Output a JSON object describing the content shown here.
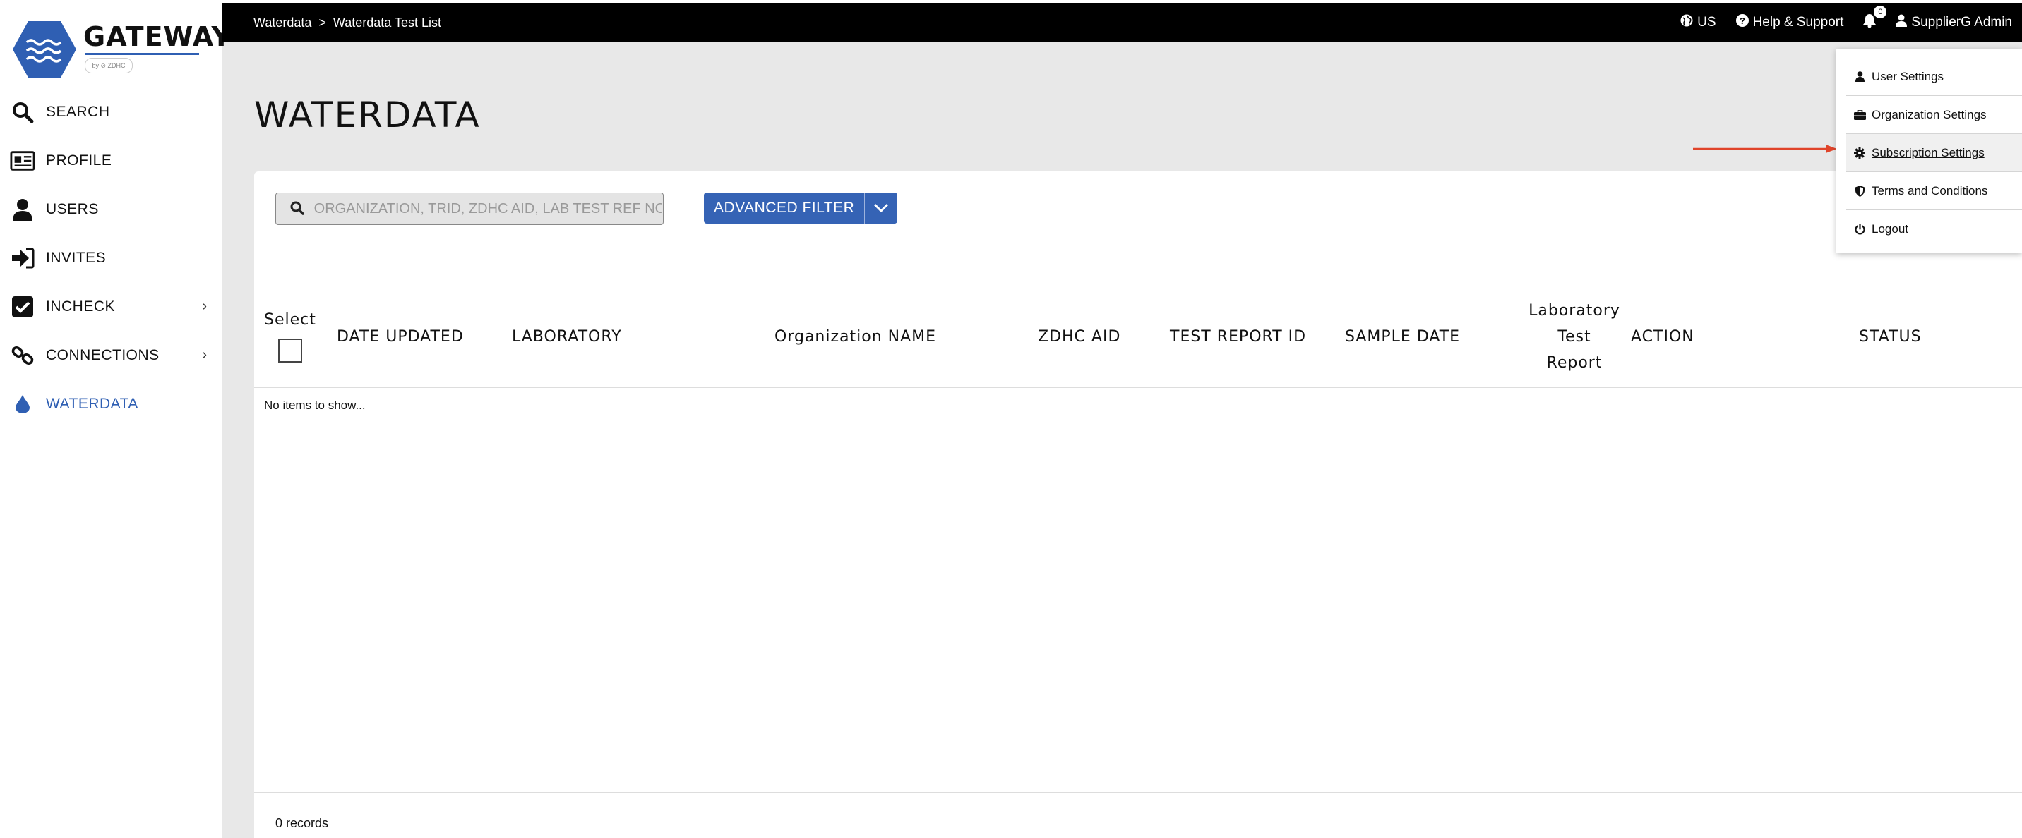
{
  "brand": {
    "name": "GATEWAY",
    "tagline": "by ⊘ ZDHC"
  },
  "sidebar": {
    "items": [
      {
        "label": "SEARCH",
        "icon": "search-icon"
      },
      {
        "label": "PROFILE",
        "icon": "profile-card-icon"
      },
      {
        "label": "USERS",
        "icon": "user-icon"
      },
      {
        "label": "INVITES",
        "icon": "sign-in-icon"
      },
      {
        "label": "INCHECK",
        "icon": "checkbox-icon",
        "has_submenu": true
      },
      {
        "label": "CONNECTIONS",
        "icon": "link-icon",
        "has_submenu": true
      },
      {
        "label": "WATERDATA",
        "icon": "water-drop-icon",
        "active": true
      }
    ]
  },
  "topbar": {
    "breadcrumb": [
      "Waterdata",
      "Waterdata Test List"
    ],
    "breadcrumb_separator": ">",
    "region": "US",
    "help": "Help & Support",
    "notifications": "0",
    "user": "SupplierG Admin"
  },
  "page": {
    "title": "WATERDATA",
    "search": {
      "placeholder": "ORGANIZATION, TRID, ZDHC AID, LAB TEST REF NO",
      "value": ""
    },
    "advanced_filter": "ADVANCED FILTER",
    "table": {
      "columns": {
        "select": "Select",
        "date_updated": "DATE UPDATED",
        "laboratory": "LABORATORY",
        "organization_name": "Organization NAME",
        "zdhc_aid": "ZDHC AID",
        "test_report_id": "TEST REPORT ID",
        "sample_date": "SAMPLE DATE",
        "lab_test_report_line1": "Laboratory",
        "lab_test_report_line2": "Test",
        "lab_test_report_line3": "Report",
        "action": "ACTION",
        "status": "STATUS"
      },
      "empty_message": "No items to show...",
      "records": "0 records"
    }
  },
  "user_menu": {
    "items": [
      {
        "label": "User Settings",
        "icon": "user-icon"
      },
      {
        "label": "Organization Settings",
        "icon": "briefcase-icon"
      },
      {
        "label": "Subscription Settings",
        "icon": "gear-icon",
        "highlighted": true
      },
      {
        "label": "Terms and Conditions",
        "icon": "shield-icon"
      },
      {
        "label": "Logout",
        "icon": "power-icon"
      }
    ]
  },
  "colors": {
    "accent": "#3563b5",
    "topbar": "#000000",
    "annotation_arrow": "#e0442a"
  }
}
